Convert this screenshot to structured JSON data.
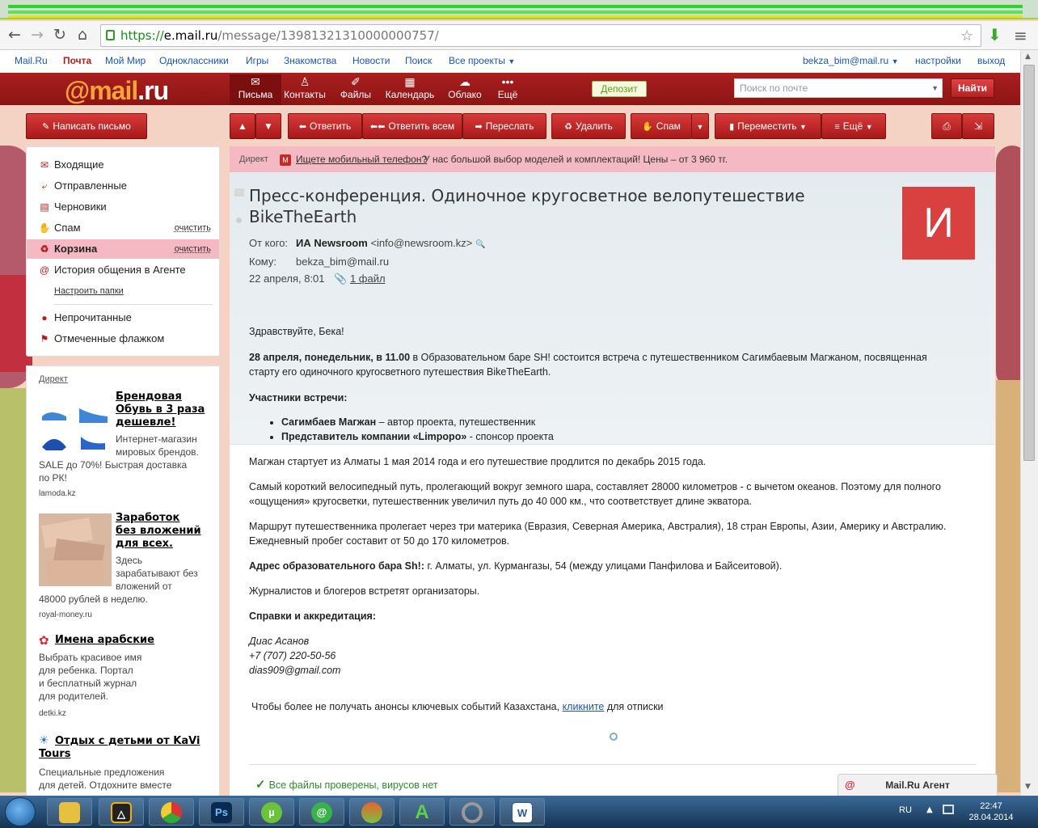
{
  "browser": {
    "url_proto": "https://",
    "url_host": "e.mail.ru",
    "url_path": "/message/13981321310000000757/"
  },
  "toplinks": {
    "mailru": "Mail.Ru",
    "pochta": "Почта",
    "moymir": "Мой Мир",
    "odnoklassniki": "Одноклассники",
    "igry": "Игры",
    "znakomstva": "Знакомства",
    "novosti": "Новости",
    "poisk": "Поиск",
    "vse_proekty": "Все проекты",
    "user": "bekza_bim@mail.ru",
    "nastroyki": "настройки",
    "vyhod": "выход"
  },
  "header": {
    "logo_at": "@mail",
    "logo_ru": ".ru",
    "services": [
      "Письма",
      "Контакты",
      "Файлы",
      "Календарь",
      "Облако",
      "Ещё"
    ],
    "deposit": "Депозит",
    "search_placeholder": "Поиск по почте",
    "find": "Найти"
  },
  "toolbar": {
    "compose": "Написать письмо",
    "reply": "Ответить",
    "reply_all": "Ответить всем",
    "forward": "Переслать",
    "delete": "Удалить",
    "spam": "Спам",
    "move": "Переместить",
    "more": "Ещё"
  },
  "folders": {
    "items": [
      {
        "label": "Входящие"
      },
      {
        "label": "Отправленные"
      },
      {
        "label": "Черновики"
      },
      {
        "label": "Спам",
        "action": "очистить"
      },
      {
        "label": "Корзина",
        "action": "очистить"
      },
      {
        "label": "История общения в Агенте"
      }
    ],
    "setup": "Настроить папки",
    "filters": [
      "Непрочитанные",
      "Отмеченные флажком"
    ]
  },
  "ads": {
    "direkt": "Директ",
    "items": [
      {
        "title": [
          "Брендовая",
          "Обувь в 3 раза",
          "дешевле!"
        ],
        "text": [
          "Интернет-магазин",
          "мировых брендов.",
          "SALE до 70%! Быстрая доставка",
          "по РК!"
        ],
        "domain": "lamoda.kz"
      },
      {
        "title": [
          "Заработок",
          "без вложений",
          "для всех."
        ],
        "text": [
          "Здесь",
          "зарабатывают без",
          "вложений от",
          "48000 рублей в неделю."
        ],
        "domain": "royal-money.ru"
      },
      {
        "title": [
          "Имена арабские"
        ],
        "text": [
          "Выбрать красивое имя",
          "для ребенка. Портал",
          "и бесплатный журнал",
          "для родителей."
        ],
        "domain": "detki.kz"
      },
      {
        "title": [
          "Отдых с детьми от KaVi",
          "Tours"
        ],
        "text": [
          "Специальные предложения",
          "для детей. Отдохните вместе"
        ],
        "domain": ""
      }
    ]
  },
  "direct_bar": {
    "label": "Директ",
    "link": "Ищете мобильный телефон?",
    "text": "У нас большой выбор моделей и комплектаций! Цены – от 3 960 тг."
  },
  "message": {
    "subject": "Пресс-конференция. Одиночное кругосветное велопутешествие BikeTheEarth",
    "from_label": "От кого:",
    "from_name": "ИА Newsroom",
    "from_email": "<info@newsroom.kz>",
    "to_label": "Кому:",
    "to": "bekza_bim@mail.ru",
    "date": "22 апреля, 8:01",
    "attachments": "1 файл",
    "avatar_letter": "И",
    "body": {
      "greeting": "Здравствуйте, Бека!",
      "p1_bold": "28 апреля, понедельник, в 11.00",
      "p1_rest": " в Образовательном баре SH! состоится встреча с путешественником Сагимбаевым Магжаном, посвященная",
      "p1_line2": "старту его одиночного кругосветного  путешествия BikeTheEarth.",
      "participants_title": "Участники встречи:",
      "participant1_bold": "Сагимбаев Магжан",
      "participant1_rest": " – автор проекта, путешественник",
      "participant2_bold": "Представитель компании «Limpopo»",
      "participant2_rest": " - спонсор проекта",
      "p2": "Магжан стартует из Алматы 1 мая 2014 года и его путешествие продлится по декабрь 2015 года.",
      "p3_line1": "Самый короткий велосипедный путь, пролегающий вокруг земного шара, составляет 28000 километров - с вычетом океанов. Поэтому для полного",
      "p3_line2": "«ощущения» кругосветки, путешественник увеличил путь до 40 000 км., что соответствует длине экватора.",
      "p4_line1": "Маршрут путешественника пролегает через три материка (Евразия, Северная Америка, Австралия), 18 стран Европы, Азии, Америку и Австралию.",
      "p4_line2": "Ежедневный пробег составит от 50 до 170 километров.",
      "address_bold": "Адрес образовательного бара Sh!:",
      "address_rest": " г. Алматы, ул. Курмангазы, 54 (между улицами Панфилова и Байсеитовой).",
      "p5": "Журналистов и блогеров встретят организаторы.",
      "refs_title": "Справки и аккредитация:",
      "contact_name": "Диас Асанов",
      "contact_phone": "+7 (707) 220-50-56",
      "contact_email": "dias909@gmail.com",
      "unsub_pre": "Чтобы более не получать анонсы ключевых событий Казахстана, ",
      "unsub_link": "кликните",
      "unsub_post": " для отписки"
    },
    "virus_check": "Все файлы проверены, вирусов нет"
  },
  "agent": "Mail.Ru Агент",
  "taskbar": {
    "lang": "RU",
    "time": "22:47",
    "date": "28.04.2014"
  },
  "colors": {
    "brand_red": "#a81818",
    "logo_orange": "#f4a43a",
    "link_blue": "#1b56b3",
    "folder_active": "#f4b9c2",
    "virus_ok": "#2f8a2f"
  }
}
